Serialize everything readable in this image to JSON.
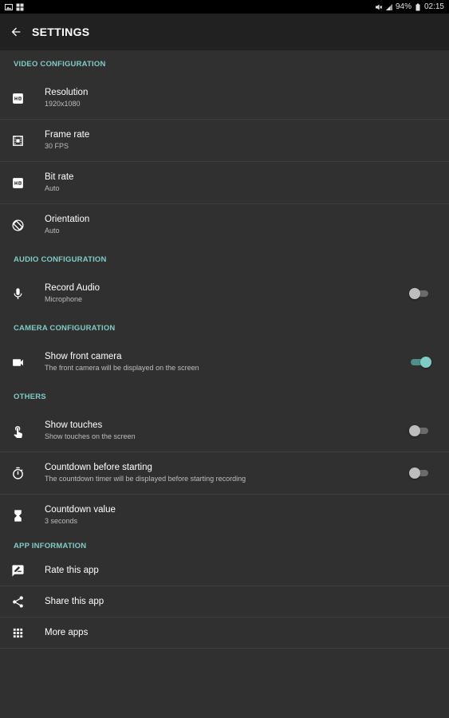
{
  "statusbar": {
    "battery": "94%",
    "time": "02:15",
    "left_icons": [
      "gallery-icon",
      "apps-icon"
    ],
    "right_icons": [
      "mute-icon",
      "signal-icon",
      "battery-icon"
    ]
  },
  "appbar": {
    "title": "SETTINGS",
    "back_icon": "arrow-back-icon"
  },
  "sections": {
    "video": {
      "header": "VIDEO CONFIGURATION",
      "resolution": {
        "title": "Resolution",
        "subtitle": "1920x1080",
        "icon": "hd-icon"
      },
      "frame_rate": {
        "title": "Frame rate",
        "subtitle": "30 FPS",
        "icon": "frame-rate-icon"
      },
      "bit_rate": {
        "title": "Bit rate",
        "subtitle": "Auto",
        "icon": "hd-icon"
      },
      "orientation": {
        "title": "Orientation",
        "subtitle": "Auto",
        "icon": "screen-rotation-icon"
      }
    },
    "audio": {
      "header": "AUDIO CONFIGURATION",
      "record_audio": {
        "title": "Record Audio",
        "subtitle": "Microphone",
        "icon": "mic-icon",
        "enabled": false
      }
    },
    "camera": {
      "header": "CAMERA CONFIGURATION",
      "front_camera": {
        "title": "Show front camera",
        "subtitle": "The front camera will be displayed on the screen",
        "icon": "videocam-icon",
        "enabled": true
      }
    },
    "others": {
      "header": "OTHERS",
      "show_touches": {
        "title": "Show touches",
        "subtitle": "Show touches on the screen",
        "icon": "touch-icon",
        "enabled": false
      },
      "countdown_start": {
        "title": "Countdown before starting",
        "subtitle": "The countdown timer will be displayed before starting recording",
        "icon": "timer-icon",
        "enabled": false
      },
      "countdown_value": {
        "title": "Countdown value",
        "subtitle": "3 seconds",
        "icon": "hourglass-icon"
      }
    },
    "app_info": {
      "header": "APP INFORMATION",
      "rate": {
        "title": "Rate this app",
        "icon": "rate-review-icon"
      },
      "share": {
        "title": "Share this app",
        "icon": "share-icon"
      },
      "more": {
        "title": "More apps",
        "icon": "apps-grid-icon"
      }
    }
  },
  "colors": {
    "background": "#303030",
    "appbar": "#212121",
    "accent": "#80cbc4",
    "divider": "#3f3f3f"
  }
}
